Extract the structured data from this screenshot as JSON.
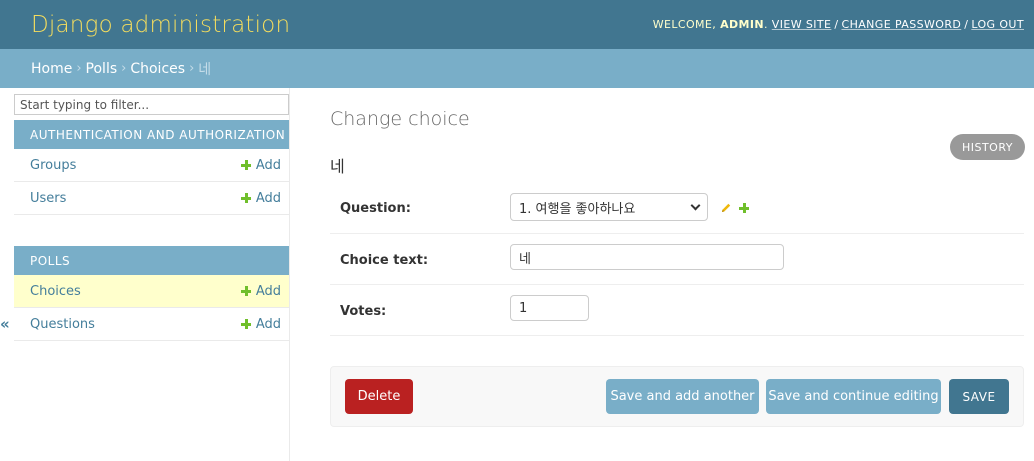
{
  "header": {
    "brand": "Django administration",
    "welcome": "WELCOME,",
    "user": "ADMIN",
    "view_site": "VIEW SITE",
    "change_password": "CHANGE PASSWORD",
    "log_out": "LOG OUT",
    "separator": "/"
  },
  "breadcrumbs": {
    "items": [
      "Home",
      "Polls",
      "Choices"
    ],
    "current": "네",
    "separator": "›"
  },
  "sidebar": {
    "filter_placeholder": "Start typing to filter...",
    "modules": [
      {
        "caption": "AUTHENTICATION AND AUTHORIZATION",
        "rows": [
          {
            "name": "Groups",
            "add": "Add"
          },
          {
            "name": "Users",
            "add": "Add"
          }
        ]
      },
      {
        "caption": "POLLS",
        "rows": [
          {
            "name": "Choices",
            "add": "Add",
            "current": true
          },
          {
            "name": "Questions",
            "add": "Add"
          }
        ]
      }
    ],
    "collapse_glyph": "«"
  },
  "content": {
    "title": "Change choice",
    "object_title": "네",
    "history_label": "HISTORY",
    "fields": {
      "question": {
        "label": "Question:",
        "value": "1. 여행을 좋아하나요"
      },
      "choice_text": {
        "label": "Choice text:",
        "value": "네"
      },
      "votes": {
        "label": "Votes:",
        "value": "1"
      }
    }
  },
  "submit": {
    "delete": "Delete",
    "save_add_another": "Save and add another",
    "save_continue": "Save and continue editing",
    "save": "SAVE"
  },
  "colors": {
    "header_bg": "#417690",
    "brand": "#f5dd5d",
    "breadcrumb_bg": "#79aec8",
    "current_row_bg": "#ffffcc",
    "delete_bg": "#ba2121",
    "add_plus": "#70bf2b"
  }
}
